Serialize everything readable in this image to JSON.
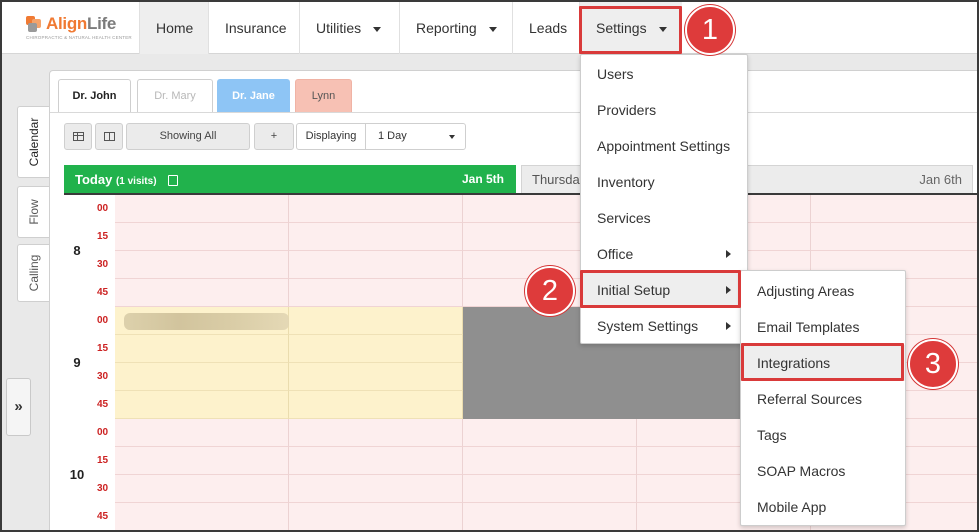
{
  "logo": {
    "brand_a": "Align",
    "brand_b": "Life",
    "tagline": "CHIROPRACTIC & NATURAL HEALTH CENTER"
  },
  "nav": {
    "home": "Home",
    "insurance": "Insurance",
    "utilities": "Utilities",
    "reporting": "Reporting",
    "leads": "Leads",
    "settings": "Settings"
  },
  "side_tabs": {
    "calendar": "Calendar",
    "flow": "Flow",
    "calling": "Calling",
    "expand": "»"
  },
  "doctor_tabs": [
    "Dr. John",
    "Dr. Mary",
    "Dr. Jane",
    "Lynn"
  ],
  "toolbar": {
    "showing": "Showing All",
    "add": "+",
    "displaying": "Displaying",
    "range": "1 Day"
  },
  "day_headers": {
    "today_label": "Today",
    "today_visits": "(1 visits)",
    "today_date": "Jan 5th",
    "next_label": "Thursday",
    "next_date": "Jan 6th"
  },
  "hours": [
    "8",
    "9",
    "10"
  ],
  "minutes": [
    "00",
    "15",
    "30",
    "45"
  ],
  "settings_menu": [
    "Users",
    "Providers",
    "Appointment Settings",
    "Inventory",
    "Services",
    "Office",
    "Initial Setup",
    "System Settings"
  ],
  "initial_setup_menu": [
    "Adjusting Areas",
    "Email Templates",
    "Integrations",
    "Referral Sources",
    "Tags",
    "SOAP Macros",
    "Mobile App"
  ],
  "callouts": [
    "1",
    "2",
    "3"
  ],
  "colors": {
    "accent_red": "#de3b3b",
    "today_green": "#21b24c",
    "tab_blue": "#8ec5f5",
    "tab_pink": "#f7c1b4"
  }
}
